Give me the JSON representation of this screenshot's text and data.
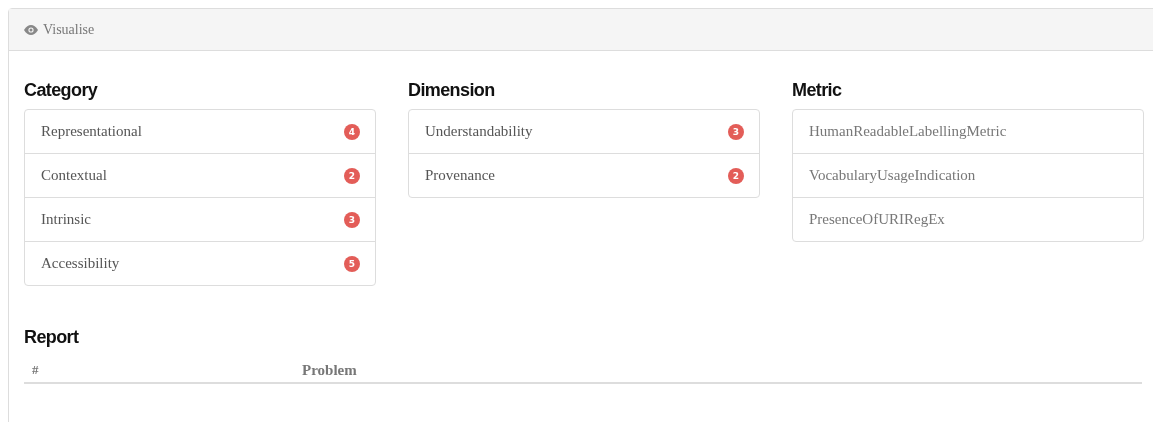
{
  "panel": {
    "title": "Visualise"
  },
  "columns": [
    {
      "title": "Category",
      "items": [
        {
          "label": "Representational",
          "count": "4"
        },
        {
          "label": "Contextual",
          "count": "2"
        },
        {
          "label": "Intrinsic",
          "count": "3"
        },
        {
          "label": "Accessibility",
          "count": "5"
        }
      ]
    },
    {
      "title": "Dimension",
      "items": [
        {
          "label": "Understandability",
          "count": "3"
        },
        {
          "label": "Provenance",
          "count": "2"
        }
      ]
    },
    {
      "title": "Metric",
      "items": [
        {
          "label": "HumanReadableLabellingMetric"
        },
        {
          "label": "VocabularyUsageIndication"
        },
        {
          "label": "PresenceOfURIRegEx"
        }
      ]
    }
  ],
  "report": {
    "title": "Report",
    "columns": [
      "#",
      "Problem"
    ]
  }
}
